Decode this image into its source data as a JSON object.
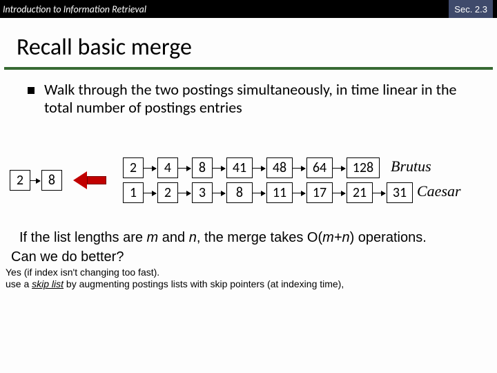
{
  "header": {
    "left": "Introduction to Information Retrieval",
    "right": "Sec. 2.3"
  },
  "title": "Recall basic merge",
  "bullet": "Walk through the two postings simultaneously, in time linear in the total number of postings entries",
  "left_pair": [
    "2",
    "8"
  ],
  "rows": {
    "top": [
      "2",
      "4",
      "8",
      "41",
      "48",
      "64",
      "128"
    ],
    "bot": [
      "1",
      "2",
      "3",
      "8",
      "11",
      "17",
      "21",
      "31"
    ]
  },
  "terms": {
    "top": "Brutus",
    "bot": "Caesar"
  },
  "complexity": {
    "pre": "If the list lengths are ",
    "m": "m",
    "mid1": " and ",
    "n": "n",
    "mid2": ", the merge takes O(",
    "mn": "m+n",
    "post": ") operations."
  },
  "question": "Can we do better?",
  "footnote": {
    "l1": "Yes (if index isn't changing too fast).",
    "l2a": "use a ",
    "skip": "skip list",
    "l2b": " by augmenting postings lists with skip pointers (at indexing time),"
  }
}
